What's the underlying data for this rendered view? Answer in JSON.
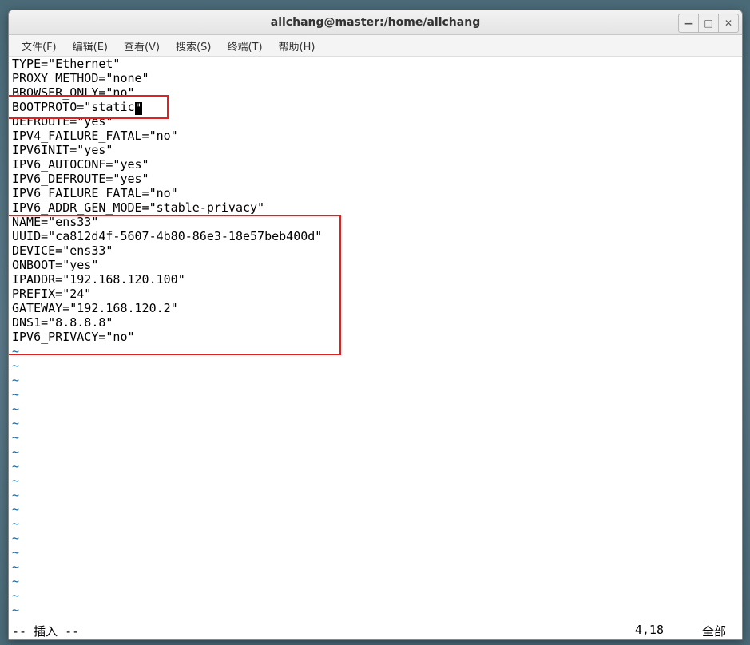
{
  "window": {
    "title": "allchang@master:/home/allchang"
  },
  "menubar": {
    "items": [
      {
        "label": "文件(F)"
      },
      {
        "label": "编辑(E)"
      },
      {
        "label": "查看(V)"
      },
      {
        "label": "搜索(S)"
      },
      {
        "label": "终端(T)"
      },
      {
        "label": "帮助(H)"
      }
    ]
  },
  "editor": {
    "lines": [
      "TYPE=\"Ethernet\"",
      "PROXY_METHOD=\"none\"",
      "BROWSER_ONLY=\"no\"",
      "BOOTPROTO=\"static\"",
      "DEFROUTE=\"yes\"",
      "IPV4_FAILURE_FATAL=\"no\"",
      "IPV6INIT=\"yes\"",
      "IPV6_AUTOCONF=\"yes\"",
      "IPV6_DEFROUTE=\"yes\"",
      "IPV6_FAILURE_FATAL=\"no\"",
      "IPV6_ADDR_GEN_MODE=\"stable-privacy\"",
      "NAME=\"ens33\"",
      "UUID=\"ca812d4f-5607-4b80-86e3-18e57beb400d\"",
      "DEVICE=\"ens33\"",
      "ONBOOT=\"yes\"",
      "IPADDR=\"192.168.120.100\"",
      "PREFIX=\"24\"",
      "GATEWAY=\"192.168.120.2\"",
      "DNS1=\"8.8.8.8\"",
      "IPV6_PRIVACY=\"no\""
    ],
    "cursor_line_index": 3,
    "cursor_col": 17,
    "tilde": "~"
  },
  "status": {
    "mode": "-- 插入 --",
    "position": "4,18",
    "scroll": "全部"
  },
  "win_controls": {
    "minimize": "—",
    "maximize": "□",
    "close": "✕"
  }
}
